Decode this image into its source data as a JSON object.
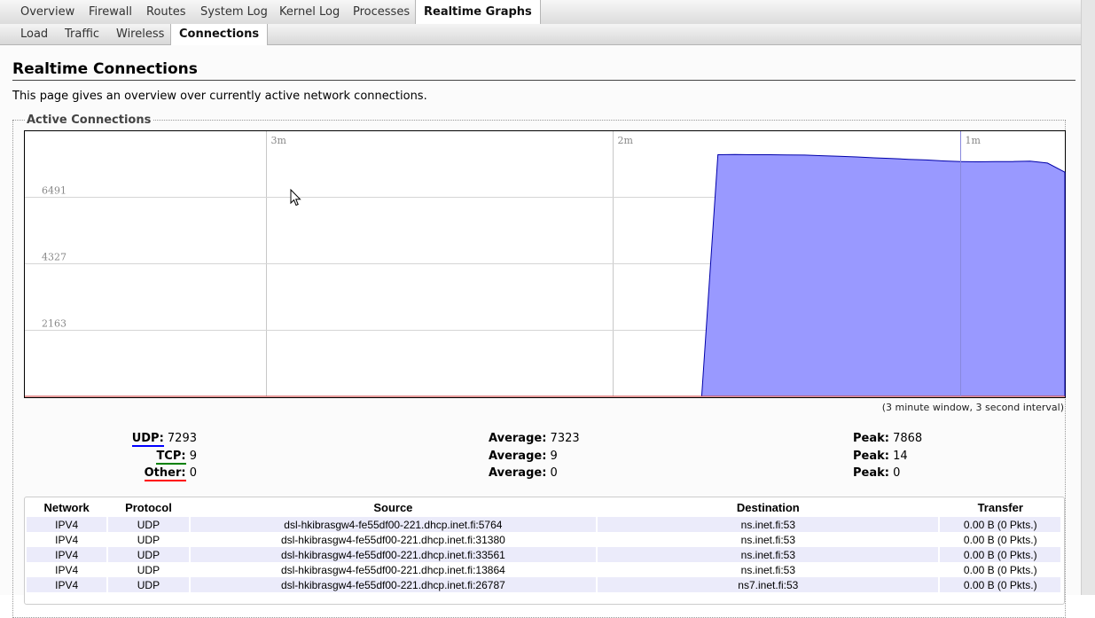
{
  "tabs": [
    "Overview",
    "Firewall",
    "Routes",
    "System Log",
    "Kernel Log",
    "Processes",
    "Realtime Graphs"
  ],
  "subtabs": [
    "Load",
    "Traffic",
    "Wireless",
    "Connections"
  ],
  "page": {
    "title": "Realtime Connections",
    "description": "This page gives an overview over currently active network connections.",
    "legend": "Active Connections",
    "interval_note": "(3 minute window, 3 second interval)"
  },
  "chart_data": {
    "type": "area",
    "x_labels": [
      "3m",
      "2m",
      "1m"
    ],
    "y_labels": [
      "6491",
      "4327",
      "2163"
    ],
    "ylim": [
      0,
      8654
    ],
    "x_unit": "seconds ago",
    "series": [
      {
        "name": "UDP",
        "color": "#0000ff",
        "values": [
          [
            60,
            7860
          ],
          [
            57,
            7868
          ],
          [
            54,
            7860
          ],
          [
            51,
            7862
          ],
          [
            48,
            7855
          ],
          [
            45,
            7850
          ],
          [
            42,
            7830
          ],
          [
            39,
            7810
          ],
          [
            36,
            7790
          ],
          [
            33,
            7760
          ],
          [
            30,
            7740
          ],
          [
            27,
            7710
          ],
          [
            24,
            7690
          ],
          [
            21,
            7660
          ],
          [
            18,
            7640
          ],
          [
            15,
            7630
          ],
          [
            12,
            7635
          ],
          [
            9,
            7640
          ],
          [
            6,
            7650
          ],
          [
            3,
            7590
          ],
          [
            0,
            7293
          ]
        ]
      },
      {
        "name": "TCP",
        "color": "#008000",
        "values": []
      },
      {
        "name": "Other",
        "color": "#ff0000",
        "values": []
      }
    ]
  },
  "stats": [
    {
      "label": "UDP:",
      "value": "7293",
      "avg_label": "Average:",
      "avg": "7323",
      "peak_label": "Peak:",
      "peak": "7868"
    },
    {
      "label": "TCP:",
      "value": "9",
      "avg_label": "Average:",
      "avg": "9",
      "peak_label": "Peak:",
      "peak": "14"
    },
    {
      "label": "Other:",
      "value": "0",
      "avg_label": "Average:",
      "avg": "0",
      "peak_label": "Peak:",
      "peak": "0"
    }
  ],
  "table": {
    "headers": [
      "Network",
      "Protocol",
      "Source",
      "Destination",
      "Transfer"
    ],
    "rows": [
      [
        "IPV4",
        "UDP",
        "dsl-hkibrasgw4-fe55df00-221.dhcp.inet.fi:5764",
        "ns.inet.fi:53",
        "0.00 B (0 Pkts.)"
      ],
      [
        "IPV4",
        "UDP",
        "dsl-hkibrasgw4-fe55df00-221.dhcp.inet.fi:31380",
        "ns.inet.fi:53",
        "0.00 B (0 Pkts.)"
      ],
      [
        "IPV4",
        "UDP",
        "dsl-hkibrasgw4-fe55df00-221.dhcp.inet.fi:33561",
        "ns.inet.fi:53",
        "0.00 B (0 Pkts.)"
      ],
      [
        "IPV4",
        "UDP",
        "dsl-hkibrasgw4-fe55df00-221.dhcp.inet.fi:13864",
        "ns.inet.fi:53",
        "0.00 B (0 Pkts.)"
      ],
      [
        "IPV4",
        "UDP",
        "dsl-hkibrasgw4-fe55df00-221.dhcp.inet.fi:26787",
        "ns7.inet.fi:53",
        "0.00 B (0 Pkts.)"
      ]
    ]
  }
}
